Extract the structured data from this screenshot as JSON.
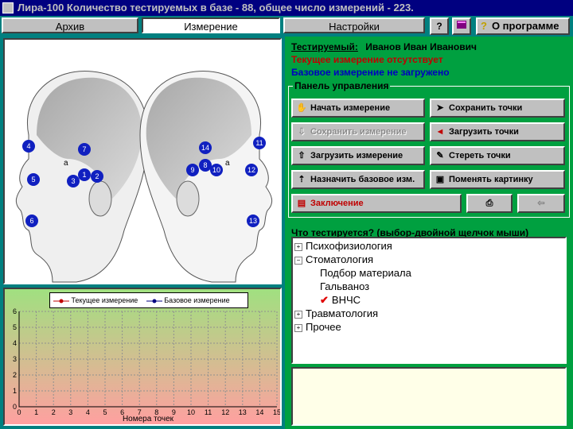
{
  "window": {
    "title": "Лира-100   Количество тестируемых в базе - 88, общее число измерений - 223."
  },
  "menu": {
    "tabs": [
      "Архив",
      "Измерение",
      "Настройки"
    ],
    "active_tab": "Измерение",
    "about_label": "О программе"
  },
  "info": {
    "subject_label": "Тестируемый:",
    "subject_name": "Иванов Иван Иванович",
    "current_status": "Текущее измерение отсутствует",
    "base_status": "Базовое измерение не загружено",
    "colors": {
      "current": "#c00000",
      "base": "#0000c0"
    }
  },
  "control_panel": {
    "title": "Панель управления",
    "buttons": {
      "start": "Начать измерение",
      "save_points": "Сохранить точки",
      "save_measure": "Сохранить измерение",
      "load_points": "Загрузить точки",
      "load_measure": "Загрузить измерение",
      "erase_points": "Стереть точки",
      "assign_base": "Назначить базовое изм.",
      "change_picture": "Поменять картинку",
      "conclusion": "Заключение"
    }
  },
  "tree": {
    "title": "Что тестируется? (выбор-двойной щелчок мыши)",
    "items": {
      "psycho": "Психофизиология",
      "dent": "Стоматология",
      "material": "Подбор материала",
      "galvan": "Гальваноз",
      "vnchs": "ВНЧС",
      "trauma": "Травматология",
      "other": "Прочее"
    }
  },
  "points": [
    "4",
    "7",
    "5",
    "3",
    "1",
    "2",
    "6",
    "14",
    "11",
    "9",
    "8",
    "10",
    "12",
    "13"
  ],
  "chart_data": {
    "type": "line",
    "xlabel": "Номера точек",
    "x_ticks": [
      "0",
      "1",
      "2",
      "3",
      "4",
      "5",
      "6",
      "7",
      "8",
      "9",
      "10",
      "11",
      "12",
      "13",
      "14",
      "15"
    ],
    "y_ticks": [
      "0",
      "1",
      "2",
      "3",
      "4",
      "5",
      "6"
    ],
    "ylim": [
      0,
      6
    ],
    "xlim": [
      0,
      15
    ],
    "series": [
      {
        "name": "Текущее измерение",
        "values": [],
        "color": "#c00000"
      },
      {
        "name": "Базовое измерение",
        "values": [],
        "color": "#000080"
      }
    ],
    "legend": "top",
    "grid": true
  }
}
